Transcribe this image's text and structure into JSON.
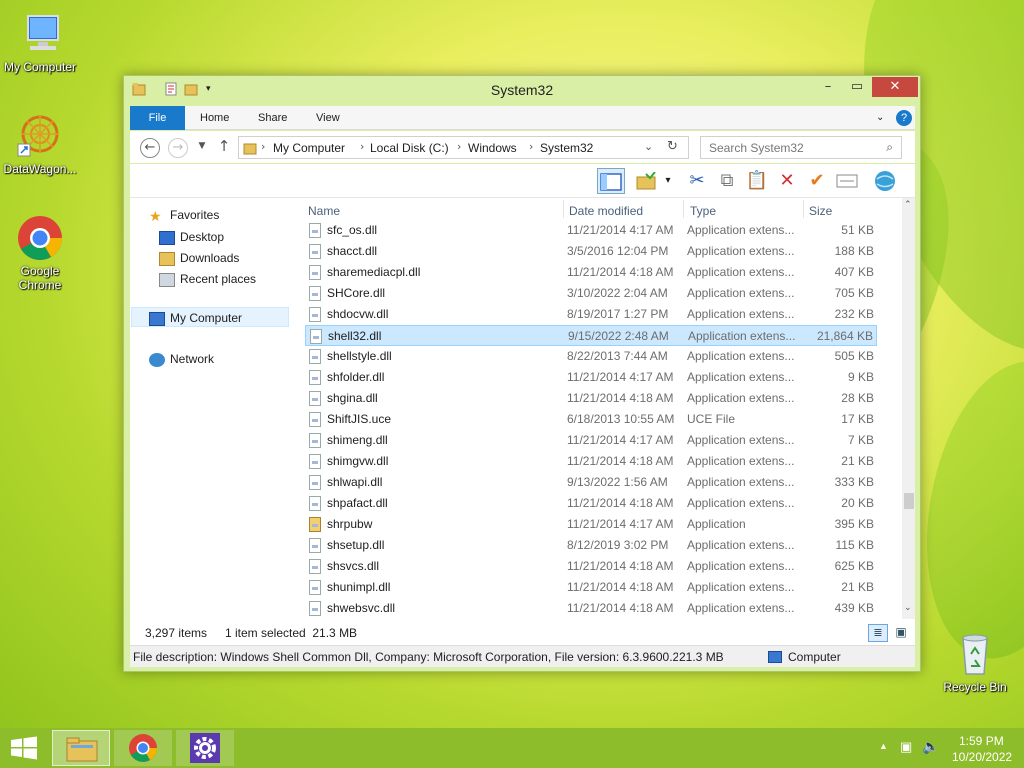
{
  "desktop": {
    "icons": [
      {
        "label": "My Computer"
      },
      {
        "label": "DataWagon..."
      },
      {
        "label": "Google Chrome"
      },
      {
        "label": "Recycle Bin"
      }
    ]
  },
  "window": {
    "title": "System32",
    "tabs": [
      {
        "label": "File"
      },
      {
        "label": "Home"
      },
      {
        "label": "Share"
      },
      {
        "label": "View"
      }
    ],
    "breadcrumb": [
      "My Computer",
      "Local Disk (C:)",
      "Windows",
      "System32"
    ],
    "search_placeholder": "Search System32"
  },
  "nav": {
    "favorites": "Favorites",
    "desktop": "Desktop",
    "downloads": "Downloads",
    "recent": "Recent places",
    "computer": "My Computer",
    "network": "Network"
  },
  "columns": {
    "name": "Name",
    "date": "Date modified",
    "type": "Type",
    "size": "Size"
  },
  "files": [
    {
      "name": "sfc_os.dll",
      "date": "11/21/2014 4:17 AM",
      "type": "Application extens...",
      "size": "51 KB"
    },
    {
      "name": "shacct.dll",
      "date": "3/5/2016 12:04 PM",
      "type": "Application extens...",
      "size": "188 KB"
    },
    {
      "name": "sharemediacpl.dll",
      "date": "11/21/2014 4:18 AM",
      "type": "Application extens...",
      "size": "407 KB"
    },
    {
      "name": "SHCore.dll",
      "date": "3/10/2022 2:04 AM",
      "type": "Application extens...",
      "size": "705 KB"
    },
    {
      "name": "shdocvw.dll",
      "date": "8/19/2017 1:27 PM",
      "type": "Application extens...",
      "size": "232 KB"
    },
    {
      "name": "shell32.dll",
      "date": "9/15/2022 2:48 AM",
      "type": "Application extens...",
      "size": "21,864 KB"
    },
    {
      "name": "shellstyle.dll",
      "date": "8/22/2013 7:44 AM",
      "type": "Application extens...",
      "size": "505 KB"
    },
    {
      "name": "shfolder.dll",
      "date": "11/21/2014 4:17 AM",
      "type": "Application extens...",
      "size": "9 KB"
    },
    {
      "name": "shgina.dll",
      "date": "11/21/2014 4:18 AM",
      "type": "Application extens...",
      "size": "28 KB"
    },
    {
      "name": "ShiftJIS.uce",
      "date": "6/18/2013 10:55 AM",
      "type": "UCE File",
      "size": "17 KB"
    },
    {
      "name": "shimeng.dll",
      "date": "11/21/2014 4:17 AM",
      "type": "Application extens...",
      "size": "7 KB"
    },
    {
      "name": "shimgvw.dll",
      "date": "11/21/2014 4:18 AM",
      "type": "Application extens...",
      "size": "21 KB"
    },
    {
      "name": "shlwapi.dll",
      "date": "9/13/2022 1:56 AM",
      "type": "Application extens...",
      "size": "333 KB"
    },
    {
      "name": "shpafact.dll",
      "date": "11/21/2014 4:18 AM",
      "type": "Application extens...",
      "size": "20 KB"
    },
    {
      "name": "shrpubw",
      "date": "11/21/2014 4:17 AM",
      "type": "Application",
      "size": "395 KB"
    },
    {
      "name": "shsetup.dll",
      "date": "8/12/2019 3:02 PM",
      "type": "Application extens...",
      "size": "115 KB"
    },
    {
      "name": "shsvcs.dll",
      "date": "11/21/2014 4:18 AM",
      "type": "Application extens...",
      "size": "625 KB"
    },
    {
      "name": "shunimpl.dll",
      "date": "11/21/2014 4:18 AM",
      "type": "Application extens...",
      "size": "21 KB"
    },
    {
      "name": "shwebsvc.dll",
      "date": "11/21/2014 4:18 AM",
      "type": "Application extens...",
      "size": "439 KB"
    }
  ],
  "selected_file": "shell32.dll",
  "status": {
    "items": "3,297 items",
    "selected": "1 item selected  21.3 MB"
  },
  "details": {
    "description": "File description: Windows Shell Common Dll, Company: Microsoft Corporation, File version: 6.3.9600.20",
    "size": "21.3 MB",
    "location": "Computer"
  },
  "clock": {
    "time": "1:59 PM",
    "date": "10/20/2022"
  },
  "colors": {
    "accent": "#1979ca",
    "selection": "#cce8ff",
    "taskbar": "#8ebd2c"
  }
}
